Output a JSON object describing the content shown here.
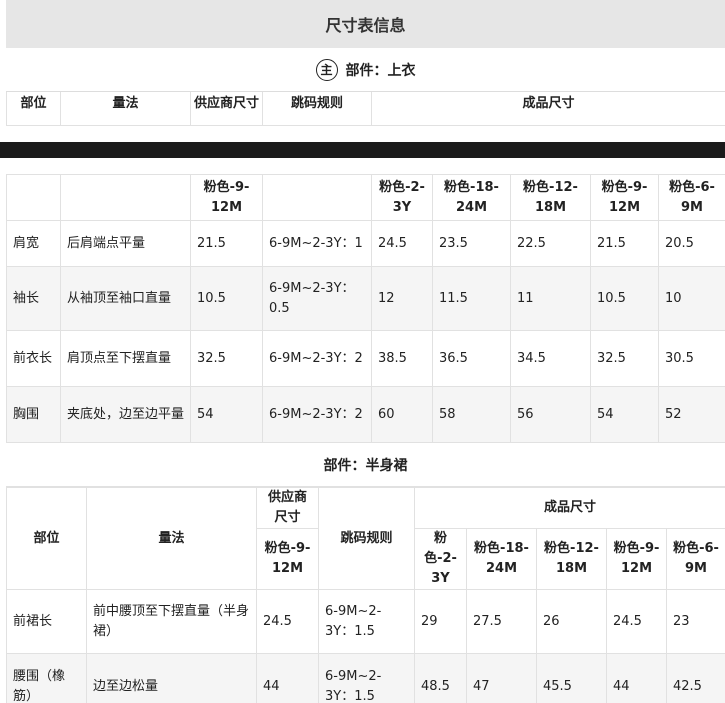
{
  "title": "尺寸表信息",
  "top_part": {
    "icon": "主",
    "label": "部件：上衣"
  },
  "top_head": {
    "col1": "部位",
    "col2": "量法",
    "col3": "供应商尺寸",
    "col4": "跳码规则",
    "col5": "成品尺寸"
  },
  "top_table": {
    "sizes_header": [
      "粉色-9-12M",
      "",
      "粉色-2-3Y",
      "粉色-18-24M",
      "粉色-12-18M",
      "粉色-9-12M",
      "粉色-6-9M"
    ],
    "rows": [
      {
        "part": "肩宽",
        "method": "后肩端点平量",
        "supplier": "21.5",
        "rule": "6-9M~2-3Y：1",
        "v": [
          "24.5",
          "23.5",
          "22.5",
          "21.5",
          "20.5"
        ]
      },
      {
        "part": "袖长",
        "method": "从袖顶至袖口直量",
        "supplier": "10.5",
        "rule": "6-9M~2-3Y：0.5",
        "v": [
          "12",
          "11.5",
          "11",
          "10.5",
          "10"
        ]
      },
      {
        "part": "前衣长",
        "method": "肩顶点至下摆直量",
        "supplier": "32.5",
        "rule": "6-9M~2-3Y：2",
        "v": [
          "38.5",
          "36.5",
          "34.5",
          "32.5",
          "30.5"
        ]
      },
      {
        "part": "胸围",
        "method": "夹底处，边至边平量",
        "supplier": "54",
        "rule": "6-9M~2-3Y：2",
        "v": [
          "60",
          "58",
          "56",
          "54",
          "52"
        ]
      }
    ]
  },
  "skirt_part": {
    "label": "部件：半身裙"
  },
  "skirt_table": {
    "head": {
      "col1": "部位",
      "col2": "量法",
      "col3": "供应商尺寸",
      "col4": "跳码规则",
      "col5": "成品尺寸"
    },
    "sizes_header": [
      "粉色-9-12M",
      "粉色-2-3Y",
      "粉色-18-24M",
      "粉色-12-18M",
      "粉色-9-12M",
      "粉色-6-9M"
    ],
    "rows": [
      {
        "part": "前裙长",
        "method": "前中腰顶至下摆直量（半身裙）",
        "supplier": "24.5",
        "rule": "6-9M~2-3Y：1.5",
        "v": [
          "29",
          "27.5",
          "26",
          "24.5",
          "23"
        ]
      },
      {
        "part": "腰围（橡筋）",
        "method": "边至边松量",
        "supplier": "44",
        "rule": "6-9M~2-3Y：1.5",
        "v": [
          "48.5",
          "47",
          "45.5",
          "44",
          "42.5"
        ]
      }
    ]
  }
}
